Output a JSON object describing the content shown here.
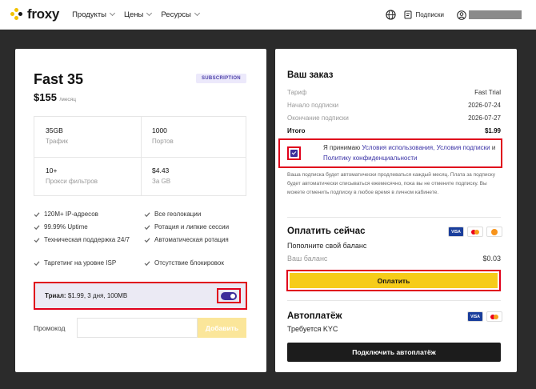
{
  "header": {
    "logo_text": "froxy",
    "nav": [
      "Продукты",
      "Цены",
      "Ресурсы"
    ],
    "subscriptions_label": "Подписки",
    "icons": [
      "globe-icon",
      "subscriptions-icon",
      "user-icon",
      "chevron-down-icon"
    ]
  },
  "plan": {
    "name": "Fast 35",
    "badge": "SUBSCRIPTION",
    "price": "$155",
    "price_unit": "/месяц",
    "stats": [
      {
        "value": "35GB",
        "label": "Трафик"
      },
      {
        "value": "1000",
        "label": "Портов"
      },
      {
        "value": "10+",
        "label": "Прокси фильтров"
      },
      {
        "value": "$4.43",
        "label": "За GB"
      }
    ],
    "features": [
      "120M+ IP-адресов",
      "Все геолокации",
      "99.99% Uptime",
      "Ротация и липкие сессии",
      "Техническая поддержка 24/7",
      "Автоматическая ротация",
      "Таргетинг на уровне ISP",
      "Отсутствие блокировок"
    ],
    "trial_label": "Триал:",
    "trial_value": "$1.99, 3 дня, 100MB",
    "trial_enabled": true,
    "promo_label": "Промокод",
    "promo_value": "",
    "promo_button": "Добавить"
  },
  "order": {
    "title": "Ваш заказ",
    "rows": [
      {
        "label": "Тариф",
        "value": "Fast Trial"
      },
      {
        "label": "Начало подписки",
        "value": "2026-07-24"
      },
      {
        "label": "Окончание подписки",
        "value": "2026-07-27"
      }
    ],
    "total_label": "Итого",
    "total_value": "$1.99",
    "accept_checked": true,
    "accept_prefix": "Я принимаю",
    "terms_link": "Условия использования,",
    "subscription_terms_link": "Условия подписки",
    "and_word": "и",
    "privacy_link": "Политику конфиденциальности",
    "note": "Ваша подписка будет автоматически продлеваться каждый месяц. Плата за подписку будет автоматически списываться ежемесячно, пока вы не отмените подписку. Вы можете отменить подписку в любое время в личном кабинете.",
    "pay_now_title": "Оплатить сейчас",
    "topup_label": "Пополните свой баланс",
    "balance_label": "Ваш баланс",
    "balance_value": "$0.03",
    "pay_button": "Оплатить",
    "autopay_title": "Автоплатёж",
    "kyc_text": "Требуется KYC",
    "autopay_button": "Подключить автоплатёж",
    "payment_cards": [
      "VISA",
      "mastercard-icon",
      "bitcoin-icon"
    ],
    "colors": {
      "accent": "#3c2d9a",
      "yellow": "#f6cc1a",
      "highlight": "#e0001b"
    }
  }
}
